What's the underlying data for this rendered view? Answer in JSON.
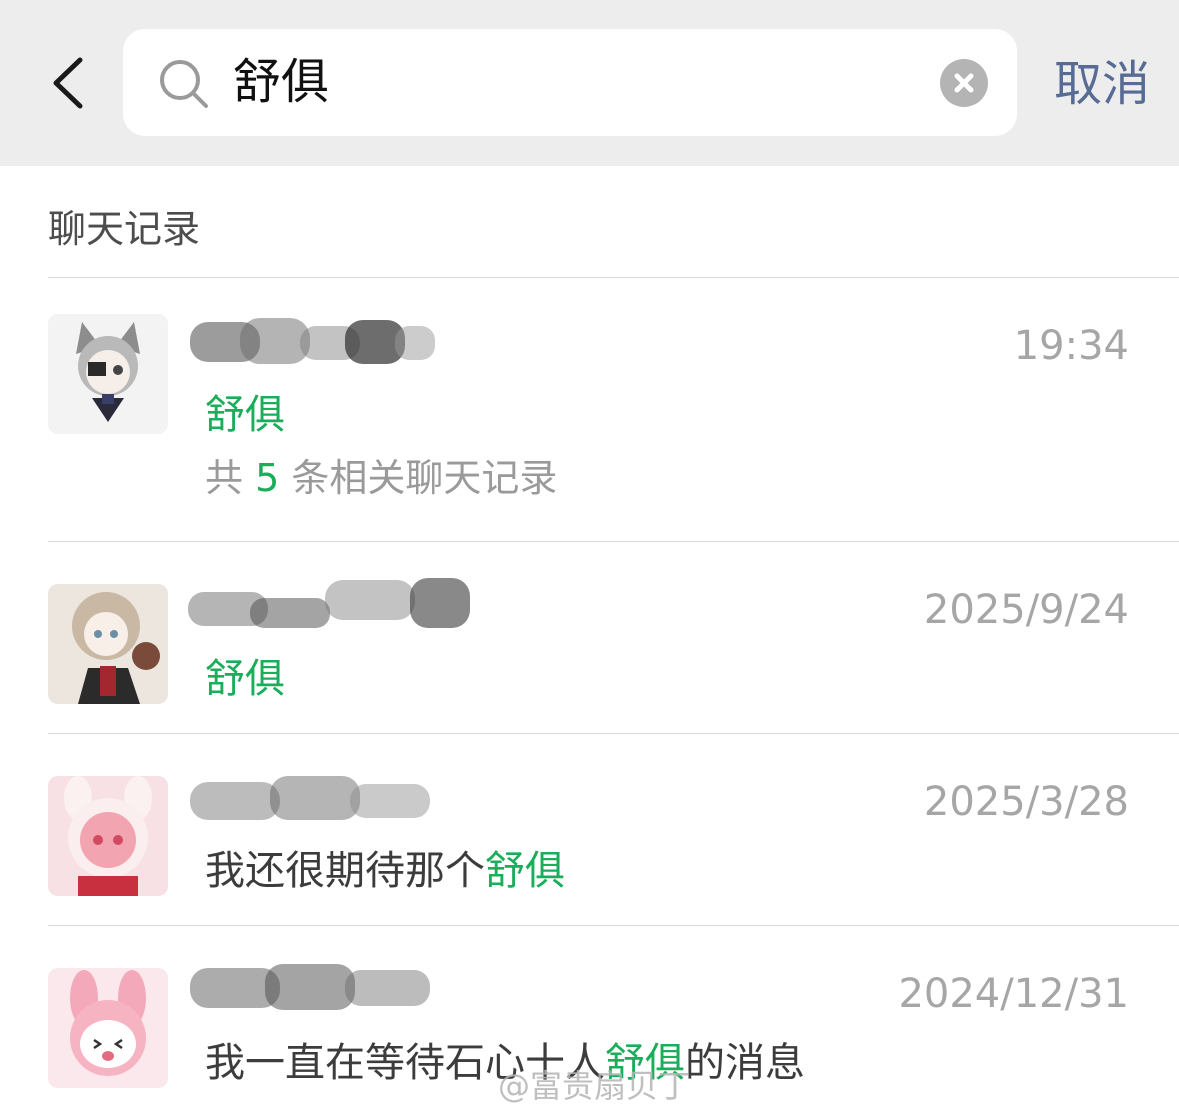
{
  "header": {
    "search_query": "舒俱",
    "cancel_label": "取消"
  },
  "section": {
    "title": "聊天记录"
  },
  "results": [
    {
      "time": "19:34",
      "line1": {
        "before": "",
        "highlight": "舒俱",
        "after": ""
      },
      "summary": {
        "prefix": "共 ",
        "count": "5",
        "suffix": " 条相关聊天记录"
      }
    },
    {
      "time": "2025/9/24",
      "line1": {
        "before": "",
        "highlight": "舒俱",
        "after": ""
      }
    },
    {
      "time": "2025/3/28",
      "line1": {
        "before": "我还很期待那个",
        "highlight": "舒俱",
        "after": ""
      }
    },
    {
      "time": "2024/12/31",
      "line1": {
        "before": "我一直在等待石心十人",
        "highlight": "舒俱",
        "after": "的消息"
      }
    }
  ],
  "watermark": "@富贵扇贝丁",
  "colors": {
    "highlight": "#1aad5a",
    "link": "#576b95",
    "header_bg": "#ededed"
  }
}
